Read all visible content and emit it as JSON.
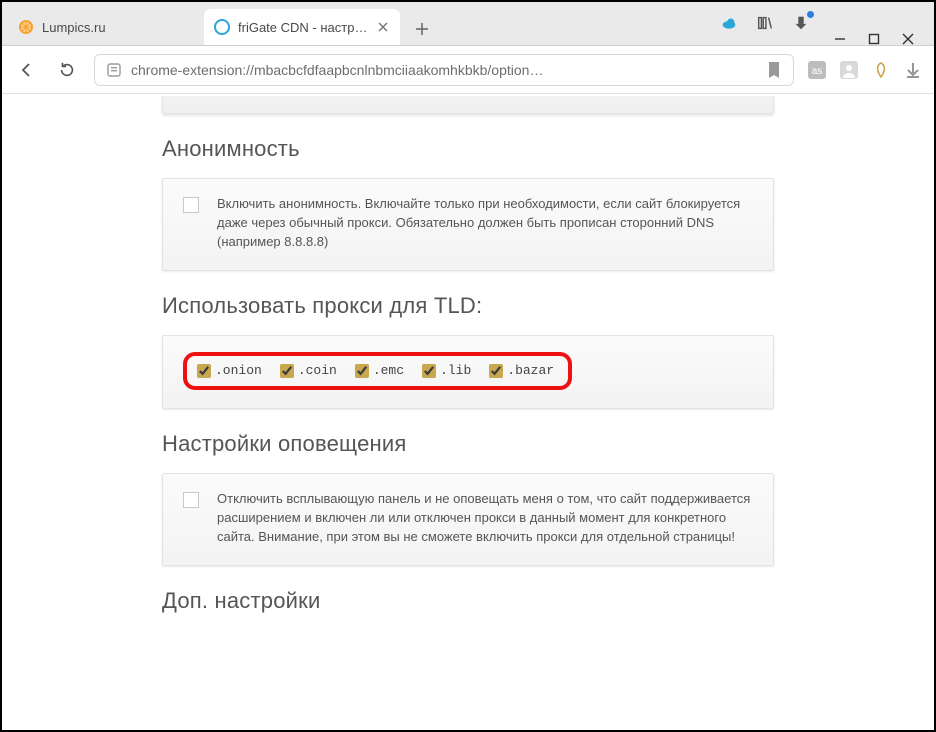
{
  "tabs": [
    {
      "title": "Lumpics.ru",
      "active": false,
      "favicon": "orange-slice"
    },
    {
      "title": "friGate CDN - настройки",
      "active": true,
      "favicon": "frigate-icon"
    }
  ],
  "omnibox": {
    "url": "chrome-extension://mbacbcfdfaapbcnlnbmciiaakomhkbkb/option…"
  },
  "sections": {
    "anonymity": {
      "title": "Анонимность",
      "checkbox_checked": false,
      "text": "Включить анонимность. Включайте только при необходимости, если сайт блокируется даже через обычный прокси. Обязательно должен быть прописан сторонний DNS (например 8.8.8.8)"
    },
    "tld": {
      "title": "Использовать прокси для TLD:",
      "items": [
        {
          "label": ".onion",
          "checked": true
        },
        {
          "label": ".coin",
          "checked": true
        },
        {
          "label": ".emc",
          "checked": true
        },
        {
          "label": ".lib",
          "checked": true
        },
        {
          "label": ".bazar",
          "checked": true
        }
      ]
    },
    "notify": {
      "title": "Настройки оповещения",
      "checkbox_checked": false,
      "text": "Отключить всплывающую панель и не оповещать меня о том, что сайт поддерживается расширением и включен ли или отключен прокси в данный момент для конкретного сайта. Внимание, при этом вы не сможете включить прокси для отдельной страницы!"
    },
    "extra": {
      "title": "Доп. настройки"
    }
  }
}
